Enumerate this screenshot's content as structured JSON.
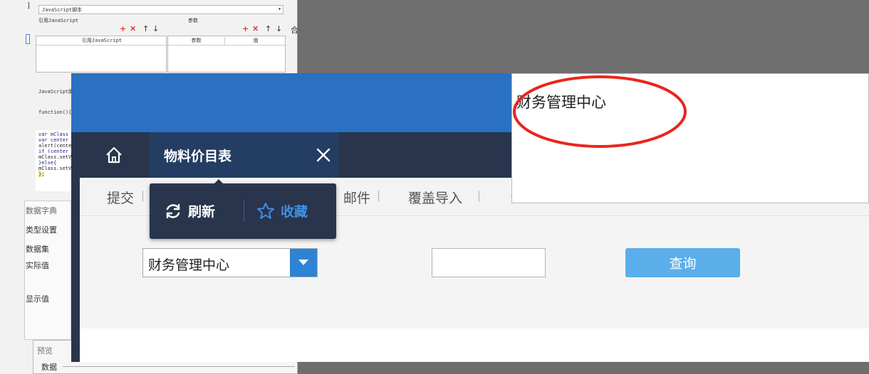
{
  "designer": {
    "script_combo": "JavaScript脚本",
    "ref_js_label": "引用JavaScript",
    "params_label": "参数",
    "col_ref_js": "引用JavaScript",
    "col_params": "参数",
    "col_value": "值",
    "js_script_label": "JavaScript脚本",
    "function_line": "function(){",
    "code_lines": [
      "var mClass",
      "var center",
      "alert(cente",
      "if (center",
      "mClass.setV",
      "}else{",
      "mClass.setV",
      "};"
    ],
    "data_dict_label": "数据字典",
    "type_setting_label": "类型设置",
    "dataset_label": "数据集",
    "actual_value_label": "实际值",
    "display_value_label": "显示值",
    "preview_label": "预览",
    "data_label": "数据"
  },
  "nav": {
    "tab_label": "物料价目表"
  },
  "toolbar": {
    "items": [
      "提交",
      "邮件",
      "覆盖导入"
    ]
  },
  "form": {
    "combo_value": "财务管理中心",
    "text_value": "",
    "query_label": "查询"
  },
  "popup": {
    "refresh_label": "刷新",
    "favorite_label": "收藏"
  },
  "dropdown": {
    "option": "财务管理中心"
  },
  "colors": {
    "header_blue": "#2a71c2",
    "nav_dark": "#28354c",
    "query_button": "#5aaeea",
    "annotation_red": "#e8261d"
  }
}
